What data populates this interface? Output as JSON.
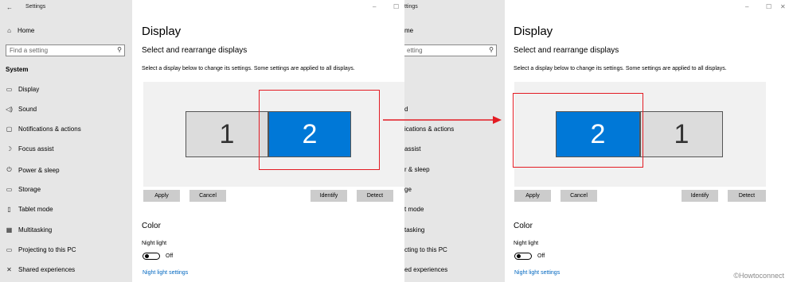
{
  "left": {
    "titlebar": {
      "back": "←",
      "title": "Settings"
    },
    "home": "Home",
    "search_placeholder": "Find a setting",
    "section": "System",
    "nav": [
      {
        "icon": "▭",
        "label": "Display"
      },
      {
        "icon": "◁)",
        "label": "Sound"
      },
      {
        "icon": "▢",
        "label": "Notifications & actions"
      },
      {
        "icon": "☽",
        "label": "Focus assist"
      },
      {
        "icon": "⏻",
        "label": "Power & sleep"
      },
      {
        "icon": "▭",
        "label": "Storage"
      },
      {
        "icon": "▯",
        "label": "Tablet mode"
      },
      {
        "icon": "▦",
        "label": "Multitasking"
      },
      {
        "icon": "▭",
        "label": "Projecting to this PC"
      },
      {
        "icon": "✕",
        "label": "Shared experiences"
      }
    ],
    "main": {
      "title": "Display",
      "subtitle": "Select and rearrange displays",
      "description": "Select a display below to change its settings. Some settings are applied to all displays.",
      "monitor_left": "1",
      "monitor_right": "2",
      "buttons": {
        "apply": "Apply",
        "cancel": "Cancel",
        "identify": "Identify",
        "detect": "Detect"
      },
      "color_heading": "Color",
      "night_light": "Night light",
      "toggle_state": "Off",
      "night_link": "Night light settings"
    }
  },
  "right": {
    "titlebar": {
      "title": "ttings"
    },
    "home": "me",
    "search_placeholder": "etting",
    "nav": [
      "d",
      "ications & actions",
      "assist",
      "r & sleep",
      "ge",
      "t mode",
      "tasking",
      "cting to this PC",
      "ed experiences"
    ],
    "main": {
      "title": "Display",
      "subtitle": "Select and rearrange displays",
      "description": "Select a display below to change its settings. Some settings are applied to all displays.",
      "monitor_left": "2",
      "monitor_right": "1",
      "buttons": {
        "apply": "Apply",
        "cancel": "Cancel",
        "identify": "Identify",
        "detect": "Detect"
      },
      "color_heading": "Color",
      "night_light": "Night light",
      "toggle_state": "Off",
      "night_link": "Night light settings"
    }
  },
  "window_controls": {
    "minimize": "–",
    "maximize": "☐",
    "close": "✕"
  },
  "watermark": "©Howtoconnect",
  "colors": {
    "accent": "#0078d7",
    "highlight": "#e31b23",
    "link": "#0067c0"
  }
}
